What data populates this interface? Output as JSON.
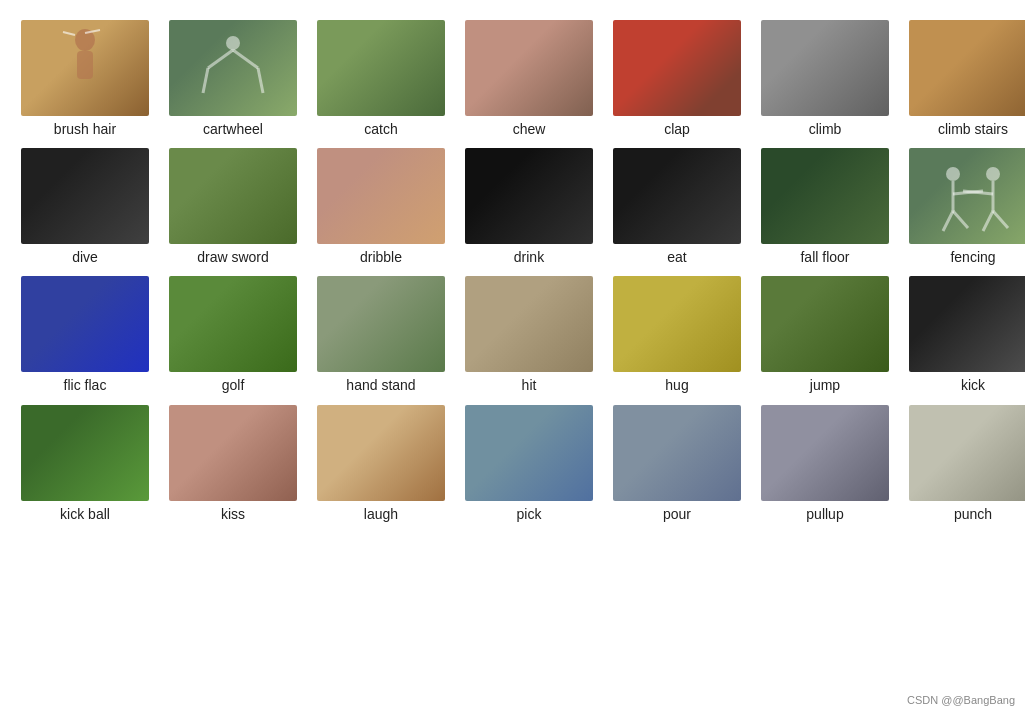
{
  "watermark": "CSDN @@BangBang",
  "items": [
    {
      "id": "brush-hair",
      "label": "brush\nhair",
      "thumb_class": "thumb-brush-hair"
    },
    {
      "id": "cartwheel",
      "label": "cartwheel",
      "thumb_class": "thumb-cartwheel"
    },
    {
      "id": "catch",
      "label": "catch",
      "thumb_class": "thumb-catch"
    },
    {
      "id": "chew",
      "label": "chew",
      "thumb_class": "thumb-chew"
    },
    {
      "id": "clap",
      "label": "clap",
      "thumb_class": "thumb-clap"
    },
    {
      "id": "climb",
      "label": "climb",
      "thumb_class": "thumb-climb"
    },
    {
      "id": "climb-stairs",
      "label": "climb\nstairs",
      "thumb_class": "thumb-climb-stairs"
    },
    {
      "id": "dive",
      "label": "dive",
      "thumb_class": "thumb-dive"
    },
    {
      "id": "draw-sword",
      "label": "draw\nsword",
      "thumb_class": "thumb-draw-sword"
    },
    {
      "id": "dribble",
      "label": "dribble",
      "thumb_class": "thumb-dribble"
    },
    {
      "id": "drink",
      "label": "drink",
      "thumb_class": "thumb-drink"
    },
    {
      "id": "eat",
      "label": "eat",
      "thumb_class": "thumb-eat"
    },
    {
      "id": "fall-floor",
      "label": "fall\nfloor",
      "thumb_class": "thumb-fall-floor"
    },
    {
      "id": "fencing",
      "label": "fencing",
      "thumb_class": "thumb-fencing"
    },
    {
      "id": "flic-flac",
      "label": "flic\nflac",
      "thumb_class": "thumb-flic-flac"
    },
    {
      "id": "golf",
      "label": "golf",
      "thumb_class": "thumb-golf"
    },
    {
      "id": "hand-stand",
      "label": "hand\nstand",
      "thumb_class": "thumb-hand-stand"
    },
    {
      "id": "hit",
      "label": "hit",
      "thumb_class": "thumb-hit"
    },
    {
      "id": "hug",
      "label": "hug",
      "thumb_class": "thumb-hug"
    },
    {
      "id": "jump",
      "label": "jump",
      "thumb_class": "thumb-jump"
    },
    {
      "id": "kick",
      "label": "kick",
      "thumb_class": "thumb-kick"
    },
    {
      "id": "kick-ball",
      "label": "kick\nball",
      "thumb_class": "thumb-kick-ball"
    },
    {
      "id": "kiss",
      "label": "kiss",
      "thumb_class": "thumb-kiss"
    },
    {
      "id": "laugh",
      "label": "laugh",
      "thumb_class": "thumb-laugh"
    },
    {
      "id": "pick",
      "label": "pick",
      "thumb_class": "thumb-pick"
    },
    {
      "id": "pour",
      "label": "pour",
      "thumb_class": "thumb-pour"
    },
    {
      "id": "pullup",
      "label": "pullup",
      "thumb_class": "thumb-pullup"
    },
    {
      "id": "punch",
      "label": "punch",
      "thumb_class": "thumb-punch"
    }
  ]
}
